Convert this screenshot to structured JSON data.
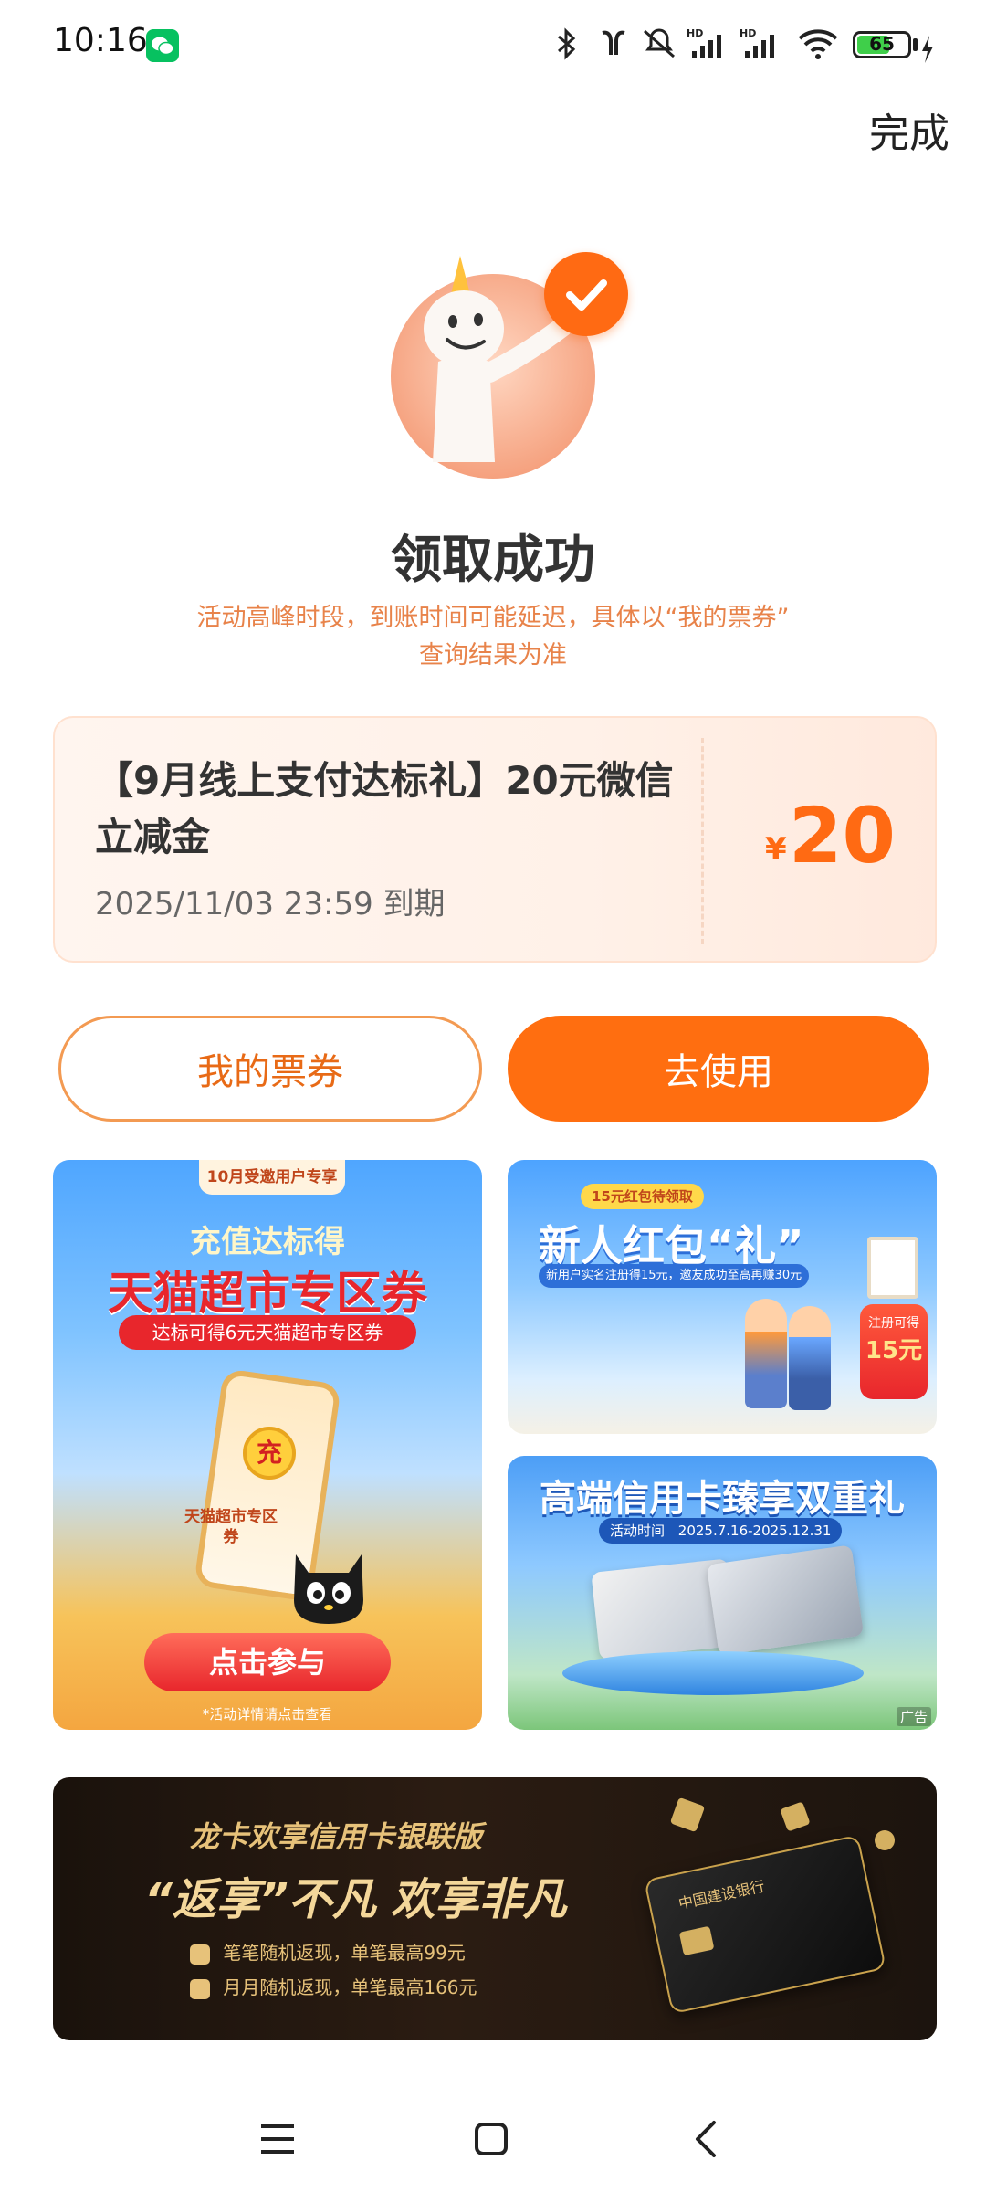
{
  "status_bar": {
    "time": "10:16",
    "battery": "65",
    "battery_level": 0.65,
    "icons": [
      "wechat-icon",
      "bluetooth-icon",
      "earbuds-icon",
      "mute-icon",
      "signal-hd-icon",
      "signal-hd-icon",
      "wifi-icon",
      "battery-icon",
      "charging-icon"
    ]
  },
  "header": {
    "done_label": "完成"
  },
  "result": {
    "title": "领取成功",
    "note_line1": "活动高峰时段，到账时间可能延迟，具体以“我的票券”",
    "note_line2": "查询结果为准"
  },
  "voucher": {
    "title": "【9月线上支付达标礼】20元微信立减金",
    "expiry": "2025/11/03 23:59 到期",
    "currency": "¥",
    "amount": "20"
  },
  "actions": {
    "my_vouchers": "我的票券",
    "use": "去使用"
  },
  "ads": {
    "tmall": {
      "tag": "10月受邀用户专享",
      "line1": "充值达标得",
      "line2": "天猫超市专区券",
      "pill": "达标可得6元天猫超市专区券",
      "phone_badge": "充",
      "card_text": "天猫超市专区券",
      "cta": "点击参与",
      "footnote": "*活动详情请点击查看"
    },
    "redpacket": {
      "tag": "15元红包待领取",
      "title": "新人红包“礼”",
      "subtitle": "新用户实名注册得15元，邀友成功至高再赚30元",
      "badge_line1": "注册可得",
      "badge_line2": "15元"
    },
    "creditcard": {
      "title": "高端信用卡臻享双重礼",
      "period_label": "活动时间",
      "period": "2025.7.16-2025.12.31",
      "ad_label": "广告"
    },
    "longcard": {
      "line1": "龙卡欢享信用卡银联版",
      "line2": "“返享”不凡 欢享非凡",
      "bullet1": "笔笔随机返现，单笔最高99元",
      "bullet2": "月月随机返现，单笔最高166元",
      "bank": "中国建设银行"
    }
  },
  "colors": {
    "accent": "#ff6e10",
    "accent_text": "#e86a16",
    "note": "#e8834a"
  }
}
